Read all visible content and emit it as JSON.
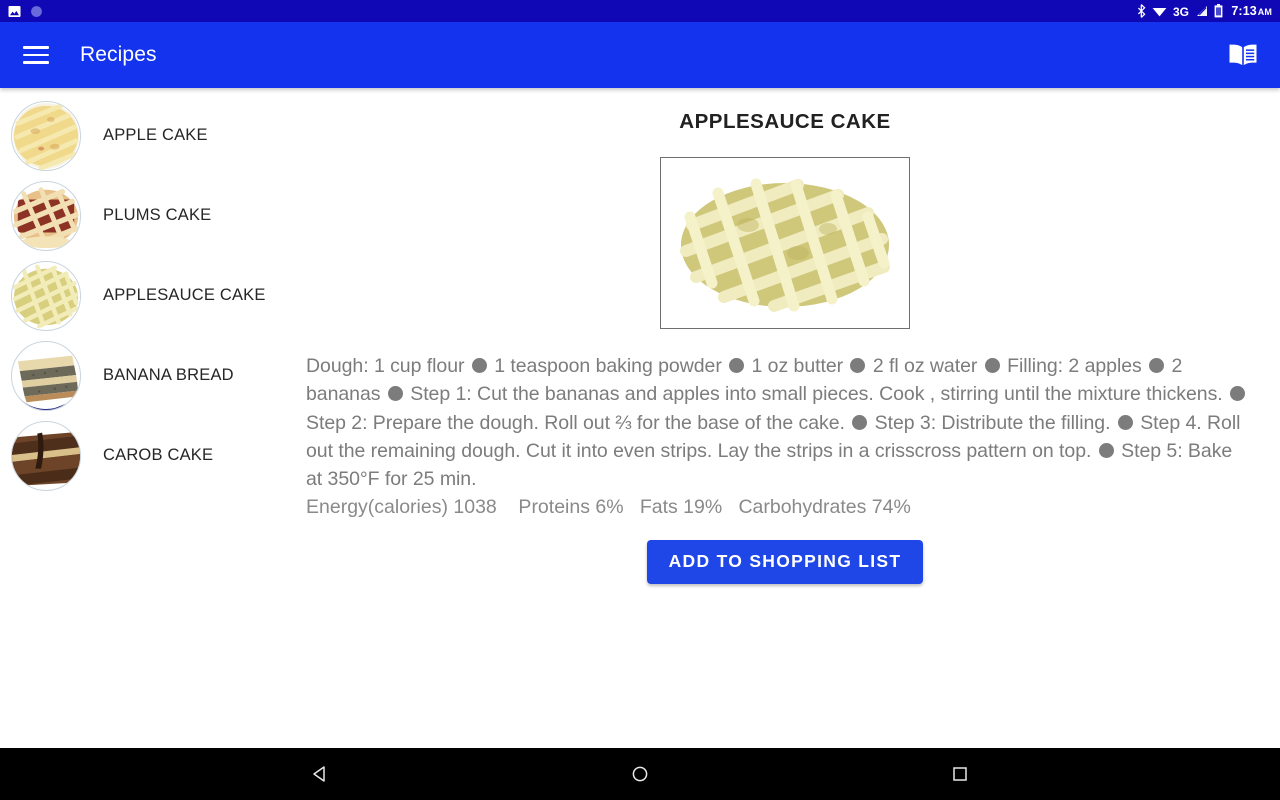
{
  "status_bar": {
    "left_icons": [
      "screenshot-image-icon",
      "circle-notification-icon"
    ],
    "right_icons": [
      "bluetooth-icon",
      "wifi-icon",
      "network-3g-icon",
      "signal-bars-icon",
      "battery-icon"
    ],
    "network_label": "3G",
    "time": "7:13",
    "meridiem": "AM",
    "background_color": "#1008b5"
  },
  "app_bar": {
    "menu_icon": "hamburger-menu-icon",
    "title": "Recipes",
    "action_icon": "menu-book-icon",
    "background_color": "#1433ef"
  },
  "sidebar": {
    "items": [
      {
        "label": "APPLE CAKE",
        "thumbnail": "apple-lattice-pie-thumb"
      },
      {
        "label": "PLUMS CAKE",
        "thumbnail": "plum-lattice-pie-thumb"
      },
      {
        "label": "APPLESAUCE CAKE",
        "thumbnail": "applesauce-lattice-pie-thumb"
      },
      {
        "label": "BANANA BREAD",
        "thumbnail": "banana-bread-slice-thumb"
      },
      {
        "label": "CAROB CAKE",
        "thumbnail": "carob-cake-slice-thumb"
      }
    ]
  },
  "detail": {
    "title": "APPLESAUCE CAKE",
    "hero_image": "applesauce-lattice-pie-photo",
    "recipe_segments": [
      "Dough: 1 cup flour",
      "1 teaspoon baking powder",
      "1 oz butter",
      "2 fl oz water",
      "Filling: 2 apples",
      "2 bananas",
      "Step 1: Cut the bananas and apples into small pieces. Cook , stirring until the mixture thickens.",
      "Step 2: Prepare the dough. Roll out ⅔ for the base of the cake.",
      "Step 3: Distribute the filling.",
      "Step 4. Roll out the remaining dough. Cut it into even strips. Lay the strips in a crisscross pattern on top.",
      "Step 5: Bake at 350°F for 25 min."
    ],
    "nutrition": "Energy(calories) 1038    Proteins 6%   Fats 19%   Carbohydrates 74%",
    "cta_label": "ADD TO SHOPPING LIST",
    "cta_color": "#1f47e8"
  },
  "nav_bar": {
    "back": "back-triangle-icon",
    "home": "home-circle-icon",
    "recents": "recents-square-icon",
    "background_color": "#000000"
  }
}
